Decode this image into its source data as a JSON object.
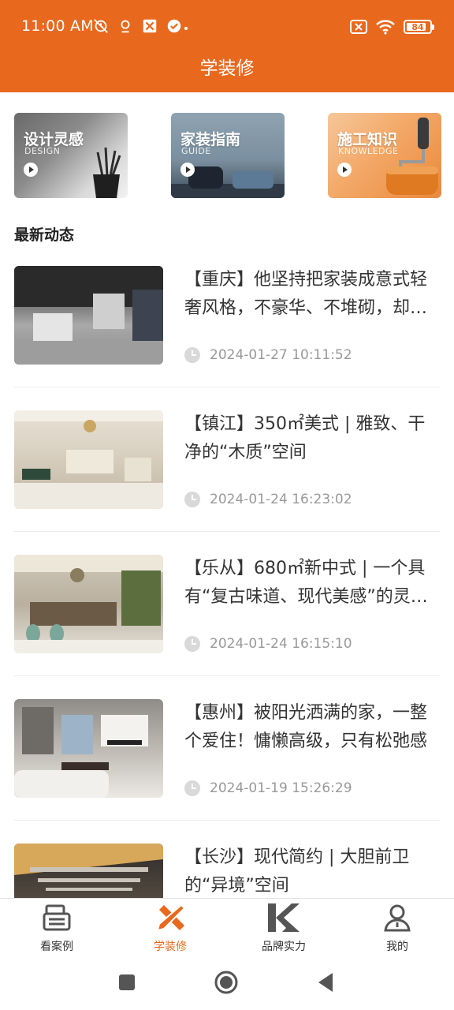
{
  "status_bar": {
    "time": "11:00 AM",
    "battery": "84",
    "battery_level": 0.84
  },
  "header": {
    "title": "学装修"
  },
  "categories": [
    {
      "title": "设计灵感",
      "subtitle": "DESIGN"
    },
    {
      "title": "家装指南",
      "subtitle": "GUIDE"
    },
    {
      "title": "施工知识",
      "subtitle": "KNOWLEDGE"
    }
  ],
  "section": {
    "title": "最新动态"
  },
  "news": [
    {
      "title": "【重庆】他坚持把家装成意式轻奢风格，不豪华、不堆砌，却处处透着高级感",
      "date": "2024-01-27 10:11:52"
    },
    {
      "title": "【镇江】350㎡美式 | 雅致、干净的“木质”空间",
      "date": "2024-01-24 16:23:02"
    },
    {
      "title": "【乐从】680㎡新中式 | 一个具有“复古味道、现代美感”的灵动空间",
      "date": "2024-01-24 16:15:10"
    },
    {
      "title": "【惠州】被阳光洒满的家，一整个爱住！慵懒高级，只有松弛感",
      "date": "2024-01-19 15:26:29"
    },
    {
      "title": "【长沙】现代简约 | 大胆前卫的“异境”空间",
      "date": ""
    }
  ],
  "tabbar": {
    "items": [
      {
        "label": "看案例",
        "icon": "case-icon"
      },
      {
        "label": "学装修",
        "icon": "ruler-pencil-icon"
      },
      {
        "label": "品牌实力",
        "icon": "brand-icon"
      },
      {
        "label": "我的",
        "icon": "user-icon"
      }
    ],
    "active_index": 1
  },
  "colors": {
    "accent": "#e8691e",
    "text": "#333333",
    "muted": "#999999"
  }
}
